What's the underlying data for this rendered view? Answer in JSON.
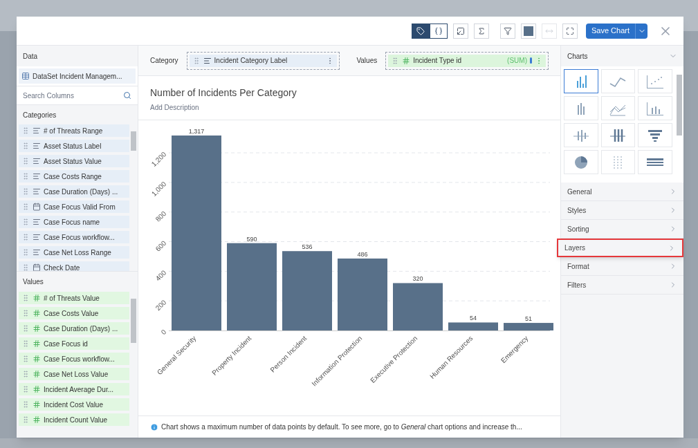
{
  "toolbar": {
    "toggles": [
      {
        "kind": "tag",
        "selected": true
      },
      {
        "kind": "braces",
        "selected": false
      }
    ],
    "save_button": "Save Chart"
  },
  "data_panel": {
    "title": "Data",
    "dataset": "DataSet Incident Managem...",
    "search": {
      "placeholder": "Search Columns"
    },
    "categories_title": "Categories",
    "categories": [
      {
        "kind": "text",
        "label": "# of Threats Range"
      },
      {
        "kind": "text",
        "label": "Asset Status Label"
      },
      {
        "kind": "text",
        "label": "Asset Status Value"
      },
      {
        "kind": "text",
        "label": "Case Costs Range"
      },
      {
        "kind": "text",
        "label": "Case Duration (Days) ..."
      },
      {
        "kind": "date",
        "label": "Case Focus Valid From"
      },
      {
        "kind": "text",
        "label": "Case Focus name"
      },
      {
        "kind": "text",
        "label": "Case Focus workflow..."
      },
      {
        "kind": "text",
        "label": "Case Net Loss Range"
      },
      {
        "kind": "date",
        "label": "Check Date"
      }
    ],
    "values_title": "Values",
    "values": [
      "# of Threats Value",
      "Case Costs Value",
      "Case Duration (Days) ...",
      "Case Focus id",
      "Case Focus workflow...",
      "Case Net Loss Value",
      "Incident Average Dur...",
      "Incident Cost Value",
      "Incident Count Value"
    ]
  },
  "fields_bar": {
    "category_label": "Category",
    "category_field": "Incident Category Label",
    "values_label": "Values",
    "value_field": "Incident Type id",
    "aggregation": "(SUM)"
  },
  "chart_title": "Number of Incidents Per Category",
  "description_placeholder": "Add Description",
  "chart": {
    "chart_data": {
      "type": "bar",
      "categories": [
        "General Security",
        "Property Incident",
        "Person Incident",
        "Information Protection",
        "Executive Protection",
        "Human Resources",
        "Emergency"
      ],
      "series": [
        {
          "color": "#587089",
          "values": [
            1317,
            590,
            536,
            486,
            320,
            54,
            51
          ]
        }
      ],
      "ylim": [
        0,
        1317
      ],
      "grid": true,
      "yticks": [
        0,
        {
          "value": 200,
          "label": "200"
        },
        {
          "value": 400,
          "label": "400"
        },
        {
          "value": 600,
          "label": "600"
        },
        {
          "value": 800,
          "label": "800"
        },
        {
          "value": 1000,
          "label": "1,000"
        },
        {
          "value": 1200,
          "label": "1,200"
        }
      ],
      "value_labels": [
        "1,317",
        "590",
        "536",
        "486",
        "320",
        "54",
        "51"
      ]
    }
  },
  "notice": "Chart shows a maximum number of data points by default. To see more, go to *General* chart options and increase th...",
  "charts_panel": {
    "title": "Charts",
    "types": [
      {
        "kind": "bar",
        "selected": true
      },
      {
        "kind": "line",
        "selected": false
      },
      {
        "kind": "scatter",
        "selected": false
      },
      {
        "kind": "stacked",
        "selected": false
      },
      {
        "kind": "area",
        "selected": false
      },
      {
        "kind": "dots",
        "selected": false
      },
      {
        "kind": "boxplot",
        "selected": false
      },
      {
        "kind": "boxes",
        "selected": false
      },
      {
        "kind": "funnel",
        "selected": false
      },
      {
        "kind": "pie",
        "selected": false
      },
      {
        "kind": "range",
        "selected": false
      },
      {
        "kind": "table",
        "selected": false
      }
    ]
  },
  "options": [
    {
      "label": "General",
      "highlighted": false
    },
    {
      "label": "Styles",
      "highlighted": false
    },
    {
      "label": "Sorting",
      "highlighted": false
    },
    {
      "label": "Layers",
      "highlighted": true
    },
    {
      "label": "Format",
      "highlighted": false
    },
    {
      "label": "Filters",
      "highlighted": false
    }
  ]
}
